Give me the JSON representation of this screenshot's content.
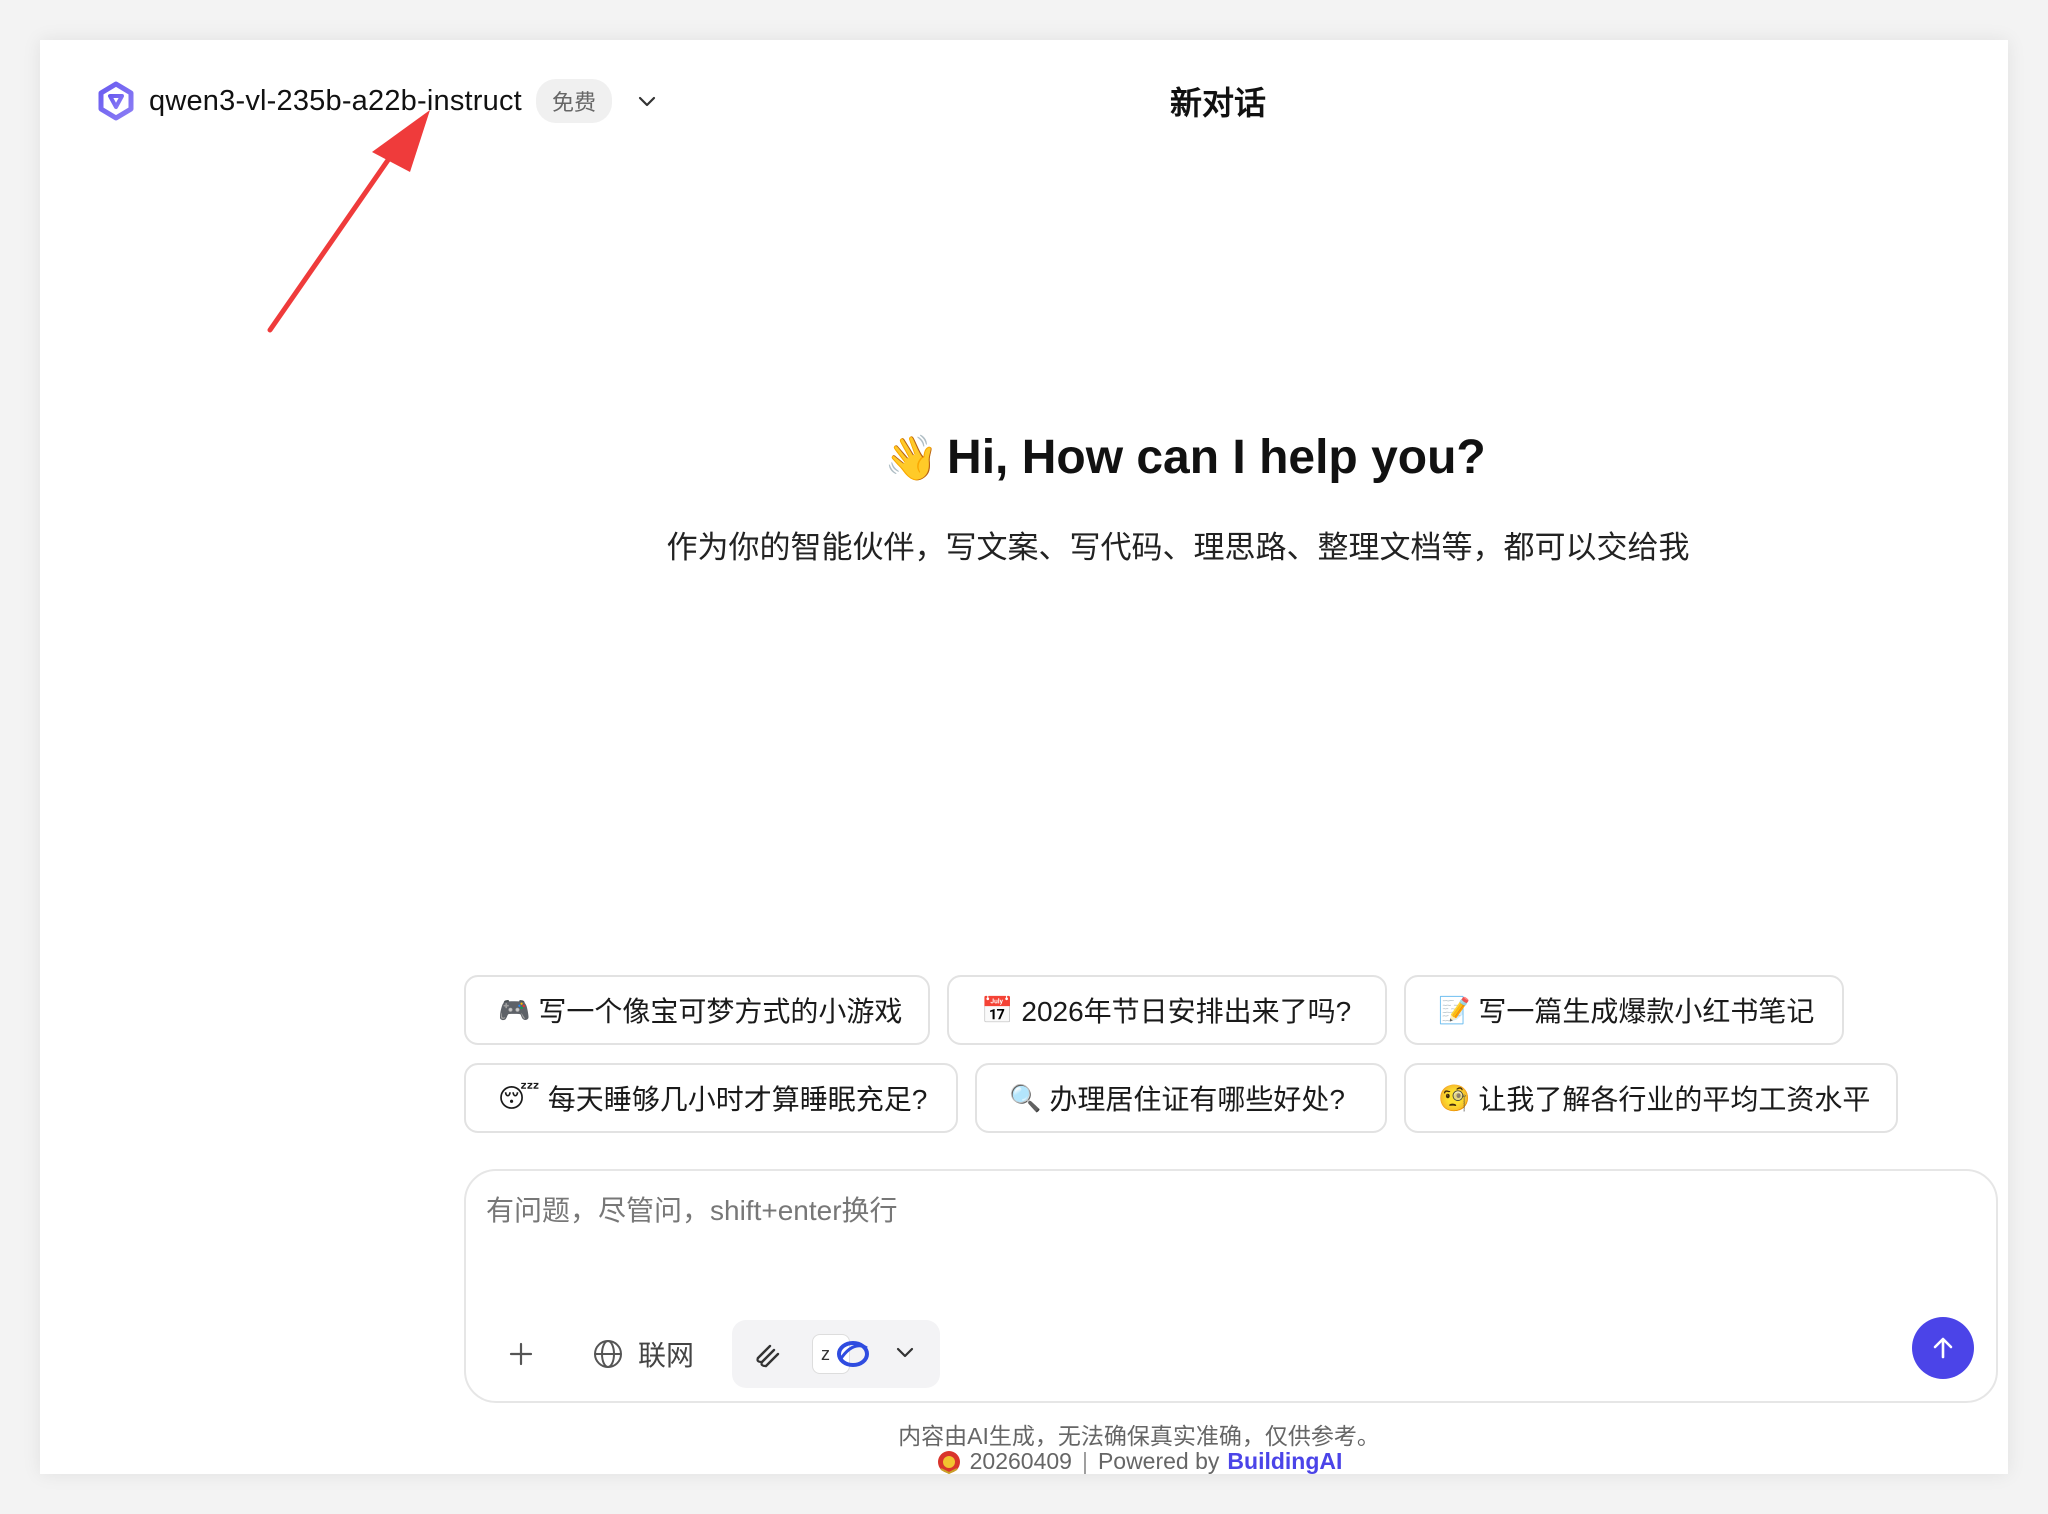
{
  "header": {
    "model_name": "qwen3-vl-235b-a22b-instruct",
    "model_badge": "免费",
    "title": "新对话"
  },
  "hero": {
    "emoji": "👋",
    "title": "Hi, How can I help you?",
    "subtitle": "作为你的智能伙伴，写文案、写代码、理思路、整理文档等，都可以交给我"
  },
  "suggestions": {
    "row1": [
      {
        "emoji": "🎮",
        "label": "写一个像宝可梦方式的小游戏"
      },
      {
        "emoji": "📅",
        "label": "2026年节日安排出来了吗?"
      },
      {
        "emoji": "📝",
        "label": "写一篇生成爆款小红书笔记"
      }
    ],
    "row2": [
      {
        "emoji": "😴",
        "label": "每天睡够几小时才算睡眠充足?"
      },
      {
        "emoji": "🔍",
        "label": "办理居住证有哪些好处?"
      },
      {
        "emoji": "🧐",
        "label": "让我了解各行业的平均工资水平"
      }
    ]
  },
  "composer": {
    "placeholder": "有问题，尽管问，shift+enter换行",
    "value": "",
    "web_label": "联网",
    "mini_app_letter": "z"
  },
  "footer": {
    "disclaimer": "内容由AI生成，无法确保真实准确，仅供参考。",
    "record": "20260409",
    "powered_by": "Powered by",
    "brand": "BuildingAI"
  },
  "colors": {
    "accent": "#4b44e8",
    "annotation_arrow": "#ef3b3b"
  }
}
